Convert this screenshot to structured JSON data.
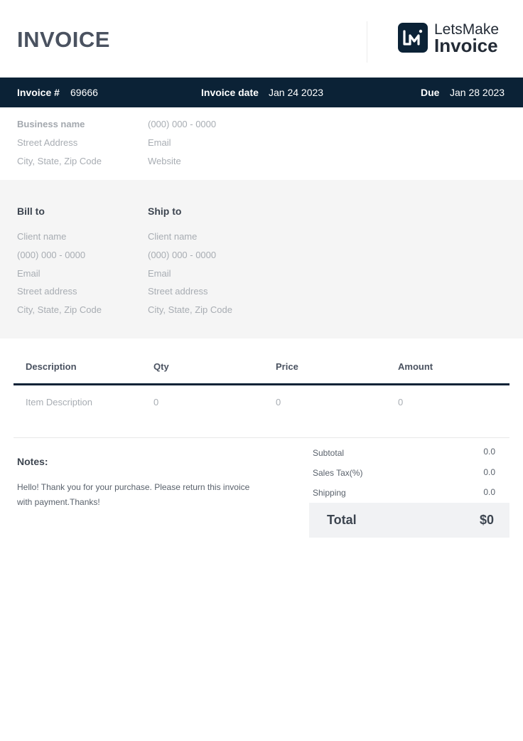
{
  "header": {
    "title": "INVOICE",
    "logo": {
      "line1": "LetsMake",
      "line2": "Invoice",
      "mark_icon": "lm-logo-mark",
      "brand_color": "#0b2236"
    }
  },
  "meta_bar": {
    "invoice_no_label": "Invoice #",
    "invoice_no": "69666",
    "date_label": "Invoice date",
    "date": "Jan 24 2023",
    "due_label": "Due",
    "due": "Jan 28 2023"
  },
  "sender": {
    "business_name": "Business name",
    "street": "Street Address",
    "city": "City, State, Zip Code",
    "phone": "(000) 000 - 0000",
    "email": "Email",
    "website": "Website"
  },
  "bill_to": {
    "heading": "Bill to",
    "client_name": "Client name",
    "phone": "(000) 000 - 0000",
    "email": "Email",
    "street": "Street address",
    "city": "City, State, Zip Code"
  },
  "ship_to": {
    "heading": "Ship to",
    "client_name": "Client name",
    "phone": "(000) 000 - 0000",
    "email": "Email",
    "street": "Street address",
    "city": "City, State, Zip Code"
  },
  "table": {
    "headers": [
      "Description",
      "Qty",
      "Price",
      "Amount"
    ],
    "rows": [
      [
        "Item Description",
        "0",
        "0",
        "0"
      ]
    ]
  },
  "notes": {
    "heading": "Notes:",
    "text": "Hello! Thank you for your purchase. Please return this invoice with payment.Thanks!"
  },
  "summary": {
    "subtotal_label": "Subtotal",
    "subtotal": "0.0",
    "tax_label": "Sales Tax(%)",
    "tax": "0.0",
    "shipping_label": "Shipping",
    "shipping": "0.0",
    "total_label": "Total",
    "total": "$0"
  }
}
